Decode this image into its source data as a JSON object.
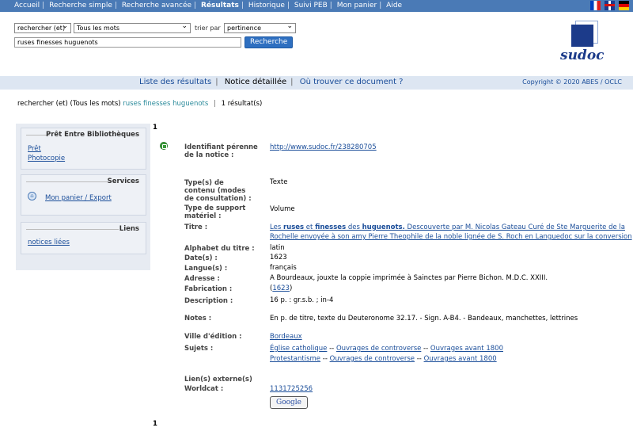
{
  "topnav": {
    "items": [
      "Accueil",
      "Recherche simple",
      "Recherche avancée",
      "Résultats",
      "Historique",
      "Suivi PEB",
      "Mon panier",
      "Aide"
    ],
    "active": "Résultats",
    "flags": [
      "flag-fr-icon",
      "flag-uk-icon",
      "flag-de-icon"
    ]
  },
  "search": {
    "mode_select": "rechercher (et)",
    "field_select": "Tous les mots",
    "sort_label": "trier par",
    "sort_select": "pertinence",
    "query": "ruses finesses huguenots",
    "button": "Recherche"
  },
  "logo": {
    "text": "sudoc"
  },
  "subnav": {
    "list_link": "Liste des résultats",
    "detail": "Notice détaillée",
    "where_link": "Où trouver ce document ?",
    "copyright": "Copyright © 2020 ABES / OCLC"
  },
  "result_line": {
    "prefix": "rechercher (et) (Tous les mots)",
    "query": "ruses finesses huguenots",
    "count": "1 résultat(s)"
  },
  "sidebar": {
    "peb_title": "Prêt Entre Bibliothèques",
    "pret": "Prêt",
    "photocopie": "Photocopie",
    "services_title": "Services",
    "panier": "Mon panier / Export",
    "liens_title": "Liens",
    "notices_liees": "notices liées"
  },
  "record": {
    "number": "1",
    "identifiant_label": "Identifiant pérenne de la notice :",
    "identifiant": "http://www.sudoc.fr/238280705",
    "type_contenu_label": "Type(s) de contenu (modes de consultation) :",
    "type_contenu": "Texte",
    "type_support_label": "Type de support matériel :",
    "type_support": "Volume",
    "titre_label": "Titre :",
    "titre_pre": "Les ",
    "titre_b1": "ruses",
    "titre_m1": " et ",
    "titre_b2": "finesses",
    "titre_m2": " des ",
    "titre_b3": "huguenots.",
    "titre_rest": " Descouverte par M. Nicolas Gateau Curé de Ste Marguerite de la",
    "titre_line2": "Rochelle envoyée à son amy Pierre Theophile de la noble lignée de S. Roch en Languedoc sur la conversion",
    "alphabet_label": "Alphabet du titre :",
    "alphabet": "latin",
    "dates_label": "Date(s) :",
    "dates": "1623",
    "langue_label": "Langue(s) :",
    "langue": "français",
    "adresse_label": "Adresse :",
    "adresse": "A Bourdeaux, jouxte la coppie imprimée à Sainctes par Pierre Bichon. M.D.C. XXIII.",
    "fabrication_label": "Fabrication :",
    "fabrication_open": "(",
    "fabrication": "1623",
    "fabrication_close": ")",
    "description_label": "Description :",
    "description": "16 p. : gr.s.b. ; in-4",
    "notes_label": "Notes :",
    "notes": "En p. de titre, texte du Deuteronome 32.17. - Sign. A-B4. - Bandeaux, manchettes, lettrines",
    "ville_label": "Ville d'édition :",
    "ville": "Bordeaux",
    "sujets_label": "Sujets :",
    "sujets_1": [
      "Église catholique",
      "Ouvrages de controverse",
      "Ouvrages avant 1800"
    ],
    "sujets_2": [
      "Protestantisme",
      "Ouvrages de controverse",
      "Ouvrages avant 1800"
    ],
    "sujets_sep": " -- ",
    "liens_label": "Lien(s) externe(s)",
    "worldcat_label": "Worldcat :",
    "worldcat": "1131725256",
    "google_button": "Google"
  }
}
